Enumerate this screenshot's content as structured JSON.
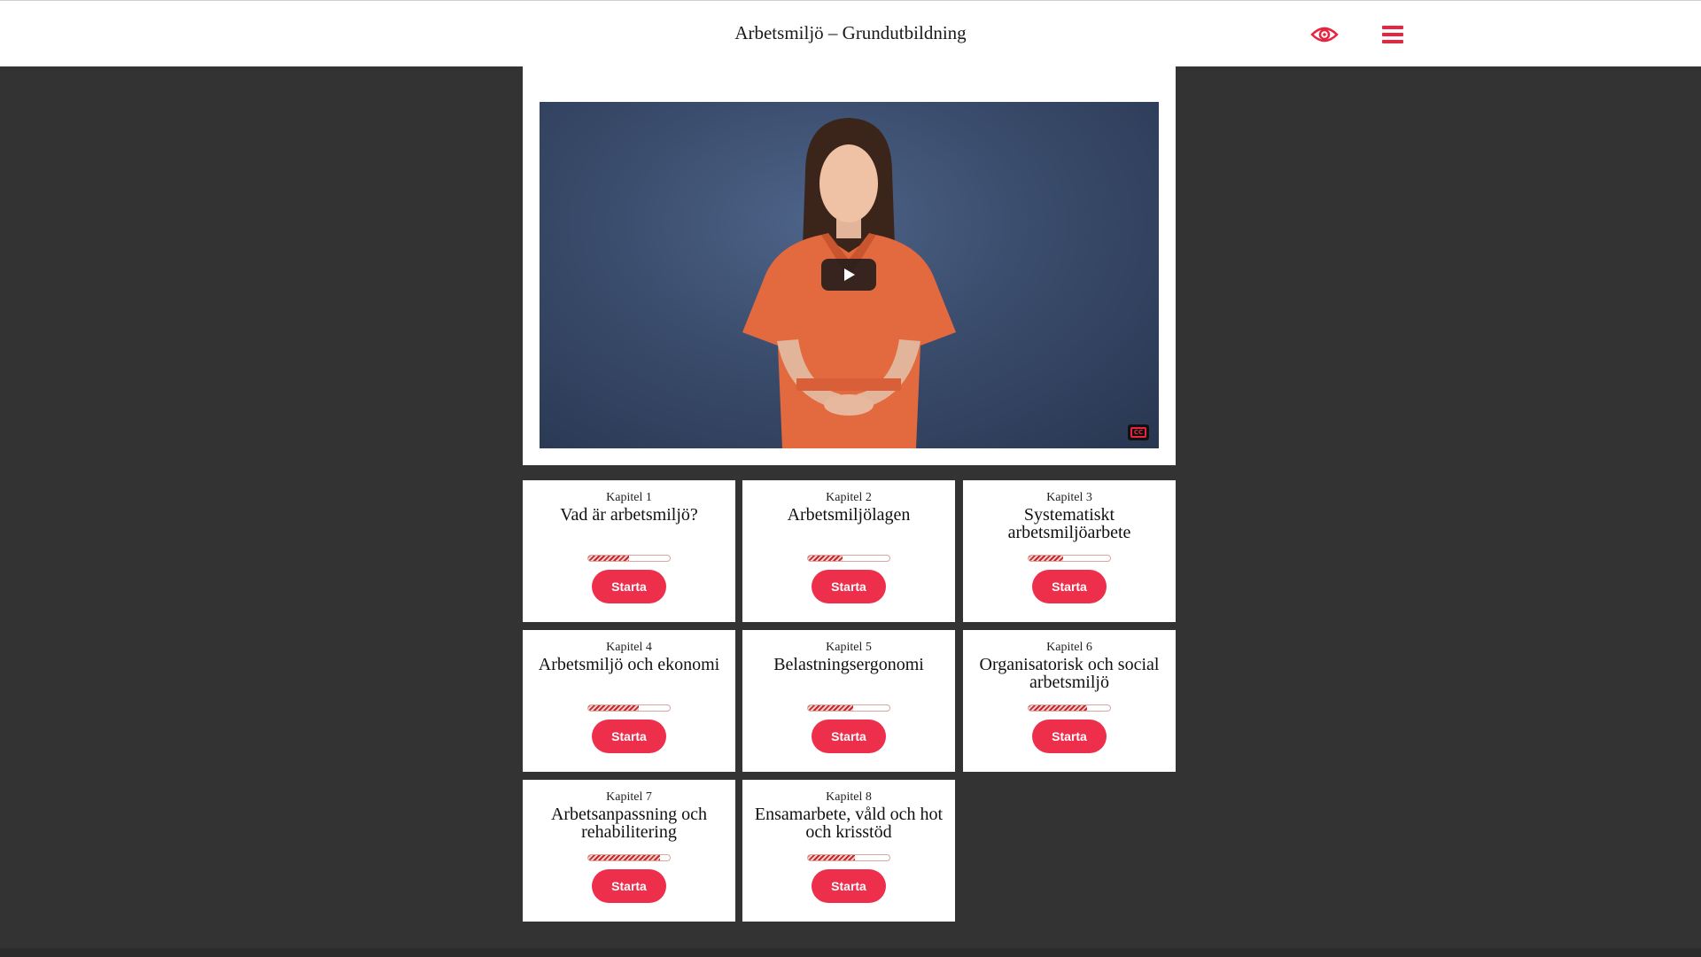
{
  "header": {
    "title": "Arbetsmiljö – Grundutbildning",
    "eye_icon": "eye-icon",
    "menu_icon": "hamburger-menu-icon",
    "accent_color": "#e8243f"
  },
  "video": {
    "play_icon": "play-icon",
    "cc_label": "CC"
  },
  "chapters": [
    {
      "label": "Kapitel 1",
      "title": "Vad är arbetsmiljö?",
      "progress": 0.5,
      "button": "Starta"
    },
    {
      "label": "Kapitel 2",
      "title": "Arbetsmiljölagen",
      "progress": 0.42,
      "button": "Starta"
    },
    {
      "label": "Kapitel 3",
      "title": "Systematiskt arbetsmiljöarbete",
      "progress": 0.42,
      "button": "Starta"
    },
    {
      "label": "Kapitel 4",
      "title": "Arbetsmiljö och ekonomi",
      "progress": 0.62,
      "button": "Starta"
    },
    {
      "label": "Kapitel 5",
      "title": "Belastningsergonomi",
      "progress": 0.55,
      "button": "Starta"
    },
    {
      "label": "Kapitel 6",
      "title": "Organisatorisk och social arbetsmiljö",
      "progress": 0.72,
      "button": "Starta"
    },
    {
      "label": "Kapitel 7",
      "title": "Arbetsanpassning och rehabilitering",
      "progress": 0.88,
      "button": "Starta"
    },
    {
      "label": "Kapitel 8",
      "title": "Ensamarbete, våld och hot och krisstöd",
      "progress": 0.58,
      "button": "Starta"
    }
  ]
}
